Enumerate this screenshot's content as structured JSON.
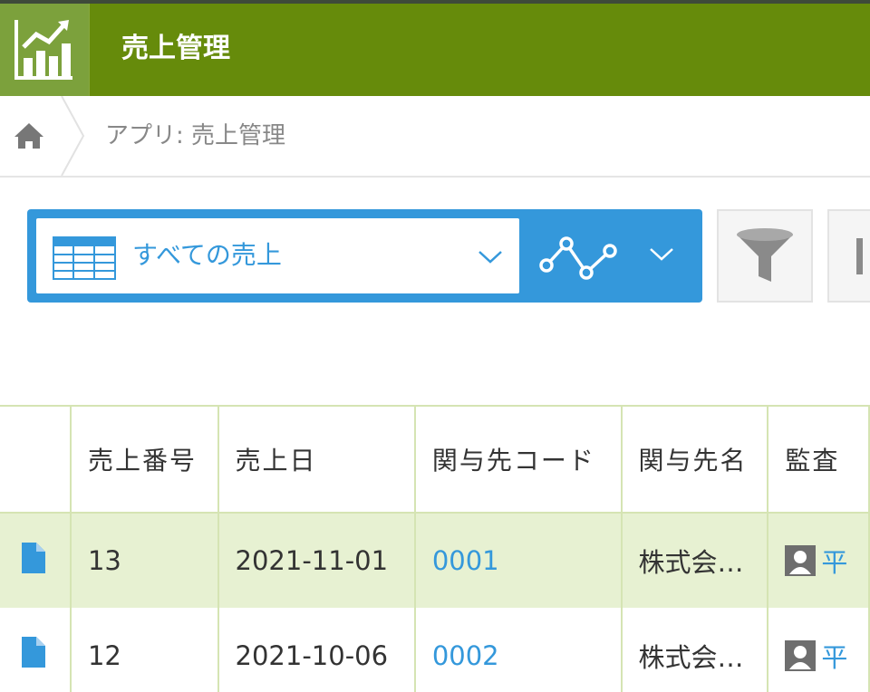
{
  "header": {
    "app_title": "売上管理",
    "app_icon": "bar-chart-up-icon",
    "bg_color": "#668b0b"
  },
  "breadcrumb": {
    "home_icon": "home-icon",
    "path": "アプリ: 売上管理"
  },
  "viewbar": {
    "view_icon": "table-icon",
    "view_name": "すべての売上",
    "graph_icon": "line-graph-icon",
    "accent_color": "#3498db"
  },
  "toolbar": {
    "filter_icon": "filter-icon",
    "next_icon": "settings-icon"
  },
  "table": {
    "columns": [
      "",
      "売上番号",
      "売上日",
      "関与先コード",
      "関与先名",
      "監査"
    ],
    "rows": [
      {
        "record_icon": "document-icon",
        "sales_no": "13",
        "sales_date": "2021-11-01",
        "client_code": "0001",
        "client_name": "株式会…",
        "auditor": "平"
      },
      {
        "record_icon": "document-icon",
        "sales_no": "12",
        "sales_date": "2021-10-06",
        "client_code": "0002",
        "client_name": "株式会…",
        "auditor": "平"
      }
    ]
  }
}
